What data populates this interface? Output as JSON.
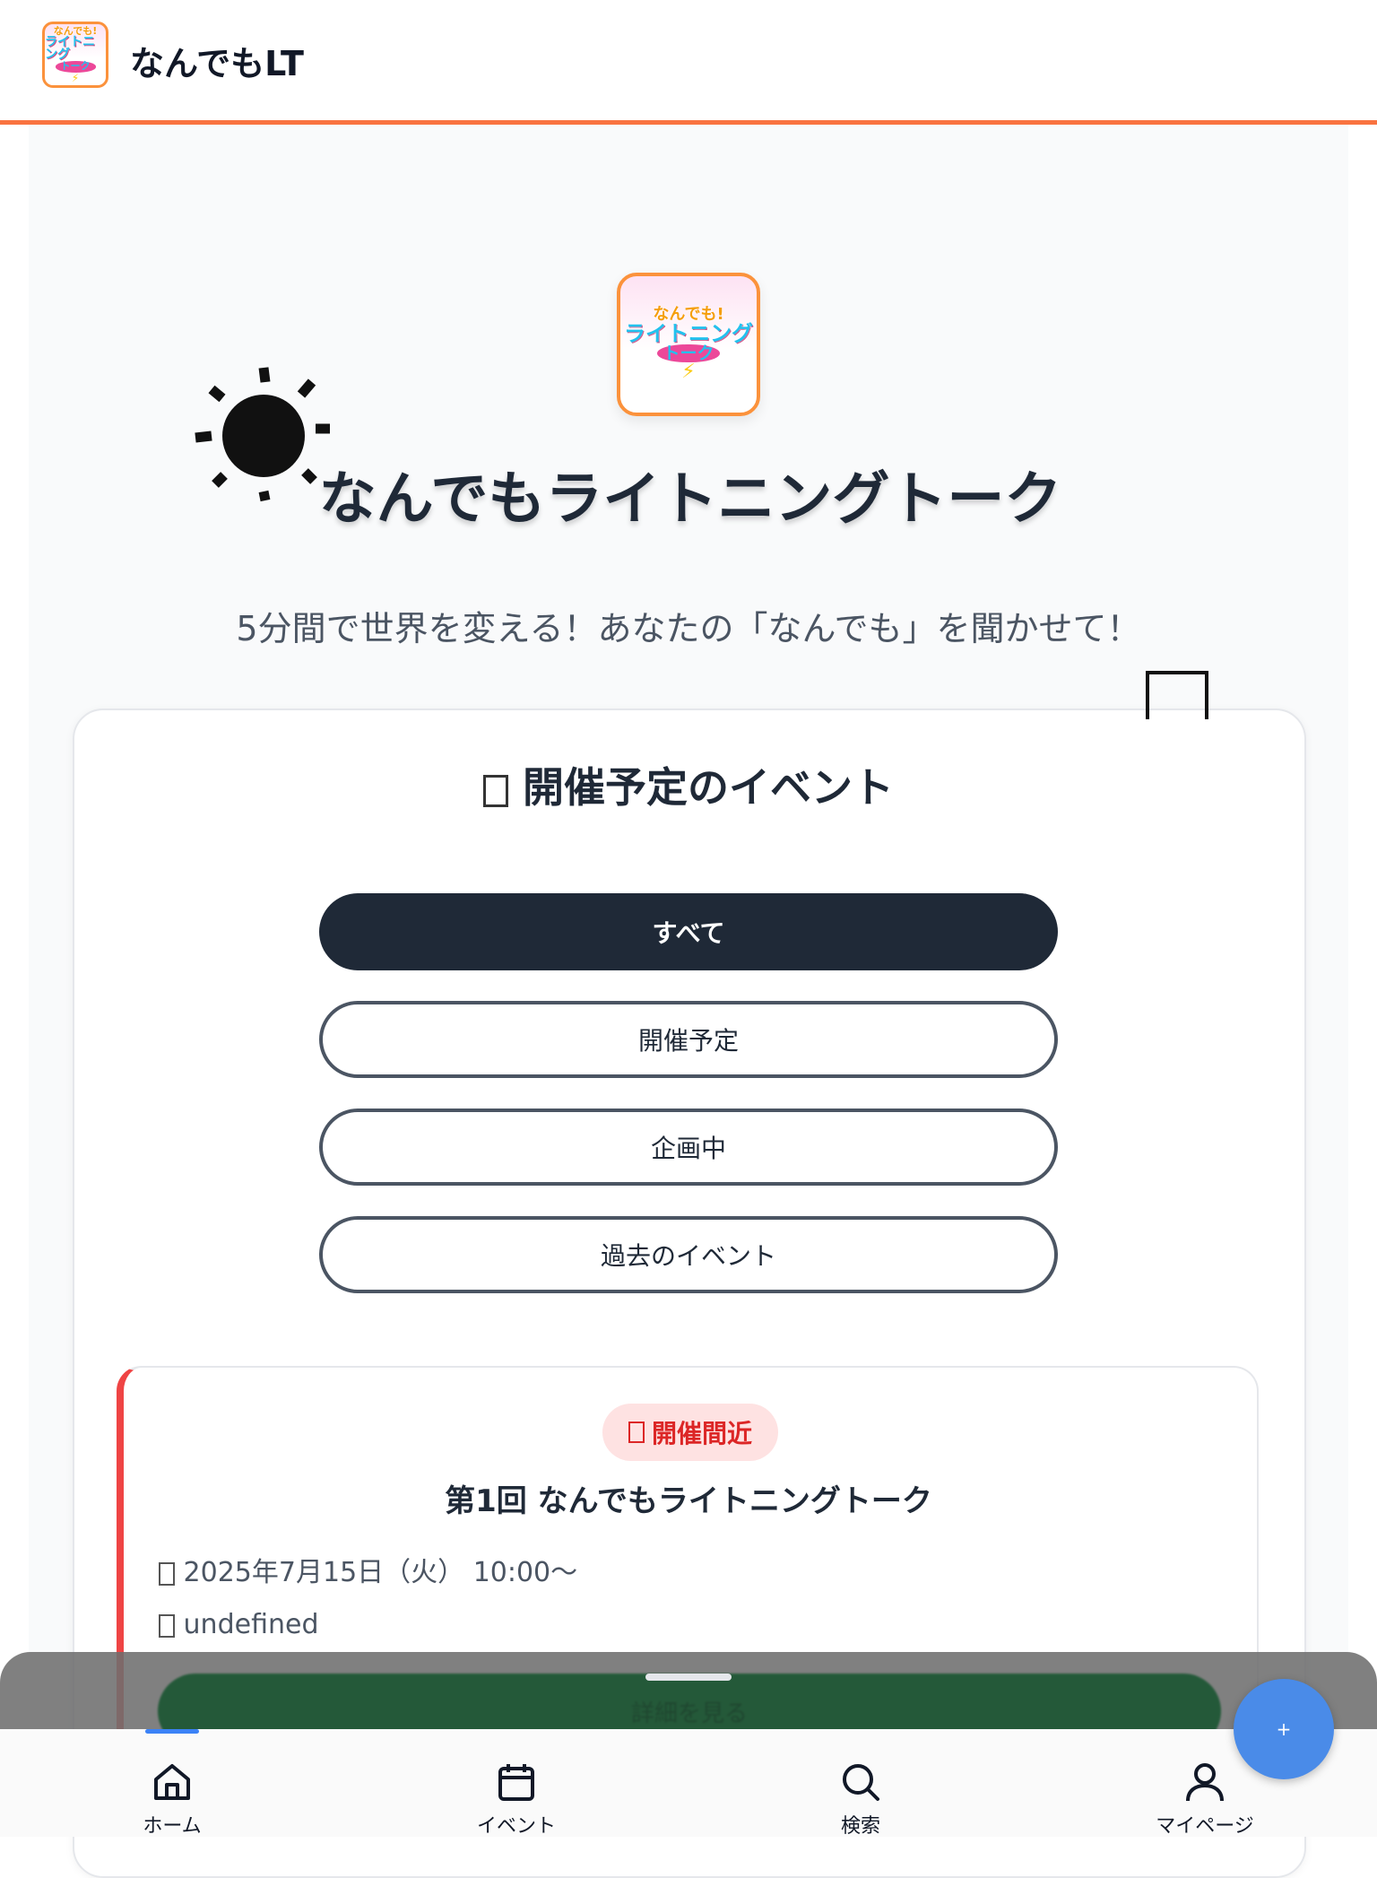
{
  "header": {
    "title": "なんでもLT",
    "logo_text": [
      "なんでも!",
      "ライトニング",
      "トーク"
    ]
  },
  "hero": {
    "logo_text": [
      "なんでも!",
      "ライトニング",
      "トーク"
    ],
    "icon": "sun-icon",
    "title": "なんでもライトニングトーク",
    "subtitle": "5分間で世界を変える！あなたの「なんでも」を聞かせて！"
  },
  "events": {
    "title": "開催予定のイベント",
    "filters": [
      {
        "label": "すべて",
        "active": true
      },
      {
        "label": "開催予定",
        "active": false
      },
      {
        "label": "企画中",
        "active": false
      },
      {
        "label": "過去のイベント",
        "active": false
      }
    ],
    "card": {
      "badge": "開催間近",
      "title": "第1回 なんでもライトニングトーク",
      "datetime": "2025年7月15日（火） 10:00〜",
      "location": "undefined",
      "accent_color": "#ef4444",
      "button_label": "詳細を見る"
    }
  },
  "nav": {
    "items": [
      {
        "label": "ホーム",
        "icon": "home-icon",
        "active": true
      },
      {
        "label": "イベント",
        "icon": "calendar-icon",
        "active": false
      },
      {
        "label": "検索",
        "icon": "search-icon",
        "active": false
      },
      {
        "label": "マイページ",
        "icon": "user-icon",
        "active": false
      }
    ],
    "fab_label": "+"
  },
  "colors": {
    "brand_orange": "#f97340",
    "active_filter": "#1f2937",
    "badge_red": "#dc2626",
    "fab_blue": "#4a8be8",
    "nav_indicator": "#3b82f6"
  }
}
